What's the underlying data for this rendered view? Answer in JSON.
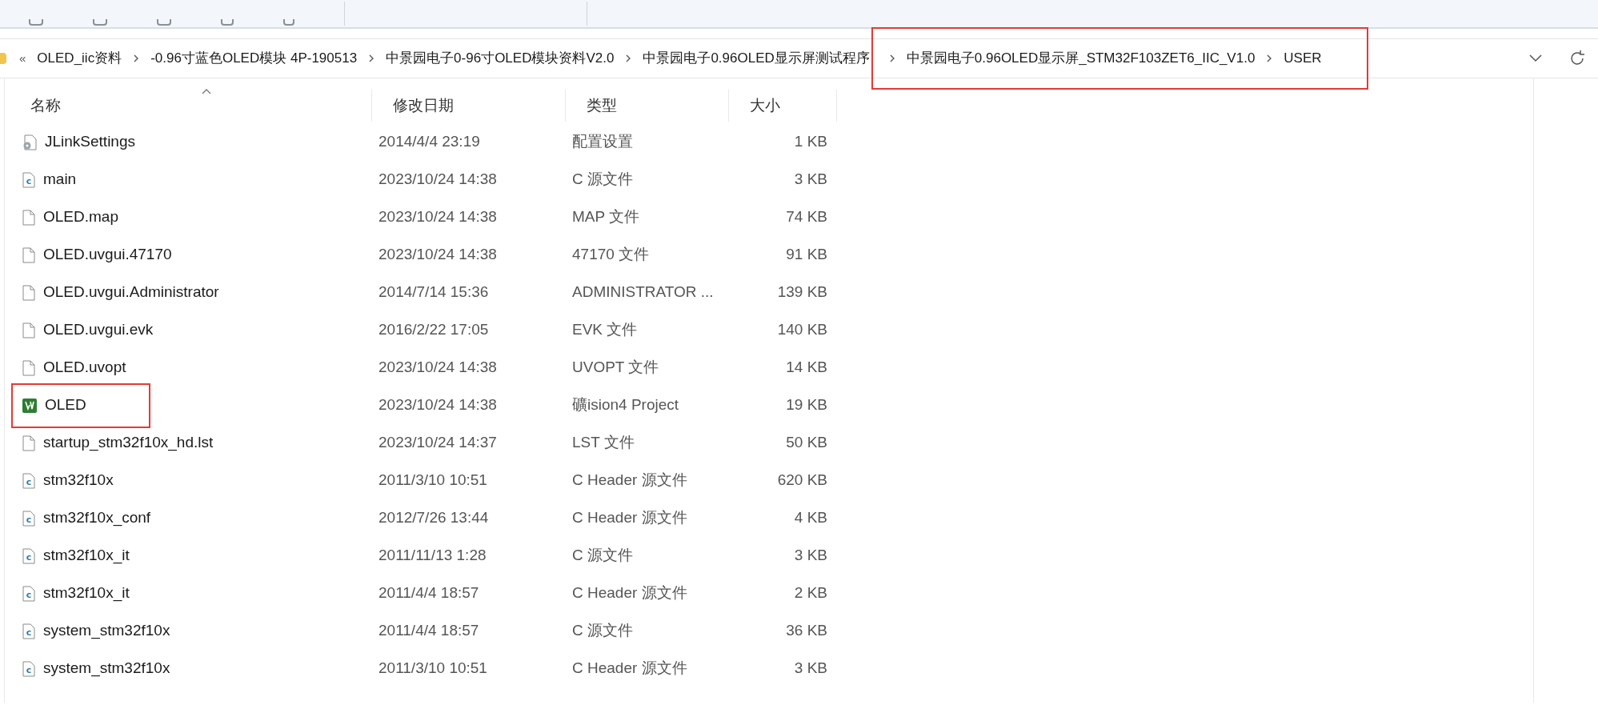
{
  "breadcrumb": {
    "overflow": "«",
    "items": [
      {
        "label": "OLED_iic资料",
        "marked": false
      },
      {
        "label": "-0.96寸蓝色OLED模块 4P-190513",
        "marked": false
      },
      {
        "label": "中景园电子0-96寸OLED模块资料V2.0",
        "marked": false
      },
      {
        "label": "中景园电子0.96OLED显示屏测试程序",
        "marked": false
      },
      {
        "label": "中景园电子0.96OLED显示屏_STM32F103ZET6_IIC_V1.0",
        "marked": true
      },
      {
        "label": "USER",
        "marked": true
      }
    ]
  },
  "table": {
    "columns": [
      {
        "label": "名称",
        "sorted": true
      },
      {
        "label": "修改日期",
        "sorted": false
      },
      {
        "label": "类型",
        "sorted": false
      },
      {
        "label": "大小",
        "sorted": false
      }
    ],
    "rows": [
      {
        "kind": "settings",
        "name": "JLinkSettings",
        "date": "2014/4/4 23:19",
        "type": "配置设置",
        "size": "1 KB",
        "marked": false
      },
      {
        "kind": "c",
        "name": "main",
        "date": "2023/10/24 14:38",
        "type": "C 源文件",
        "size": "3 KB",
        "marked": false
      },
      {
        "kind": "file",
        "name": "OLED.map",
        "date": "2023/10/24 14:38",
        "type": "MAP 文件",
        "size": "74 KB",
        "marked": false
      },
      {
        "kind": "file",
        "name": "OLED.uvgui.47170",
        "date": "2023/10/24 14:38",
        "type": "47170 文件",
        "size": "91 KB",
        "marked": false
      },
      {
        "kind": "file",
        "name": "OLED.uvgui.Administrator",
        "date": "2014/7/14 15:36",
        "type": "ADMINISTRATOR ...",
        "size": "139 KB",
        "marked": false
      },
      {
        "kind": "file",
        "name": "OLED.uvgui.evk",
        "date": "2016/2/22 17:05",
        "type": "EVK 文件",
        "size": "140 KB",
        "marked": false
      },
      {
        "kind": "file",
        "name": "OLED.uvopt",
        "date": "2023/10/24 14:38",
        "type": "UVOPT 文件",
        "size": "14 KB",
        "marked": false
      },
      {
        "kind": "project",
        "name": "OLED",
        "date": "2023/10/24 14:38",
        "type": "礦ision4 Project",
        "size": "19 KB",
        "marked": true
      },
      {
        "kind": "file",
        "name": "startup_stm32f10x_hd.lst",
        "date": "2023/10/24 14:37",
        "type": "LST 文件",
        "size": "50 KB",
        "marked": false
      },
      {
        "kind": "c",
        "name": "stm32f10x",
        "date": "2011/3/10 10:51",
        "type": "C Header 源文件",
        "size": "620 KB",
        "marked": false
      },
      {
        "kind": "c",
        "name": "stm32f10x_conf",
        "date": "2012/7/26 13:44",
        "type": "C Header 源文件",
        "size": "4 KB",
        "marked": false
      },
      {
        "kind": "c",
        "name": "stm32f10x_it",
        "date": "2011/11/13 1:28",
        "type": "C 源文件",
        "size": "3 KB",
        "marked": false
      },
      {
        "kind": "c",
        "name": "stm32f10x_it",
        "date": "2011/4/4 18:57",
        "type": "C Header 源文件",
        "size": "2 KB",
        "marked": false
      },
      {
        "kind": "c",
        "name": "system_stm32f10x",
        "date": "2011/4/4 18:57",
        "type": "C 源文件",
        "size": "36 KB",
        "marked": false
      },
      {
        "kind": "c",
        "name": "system_stm32f10x",
        "date": "2011/3/10 10:51",
        "type": "C Header 源文件",
        "size": "3 KB",
        "marked": false
      }
    ]
  }
}
